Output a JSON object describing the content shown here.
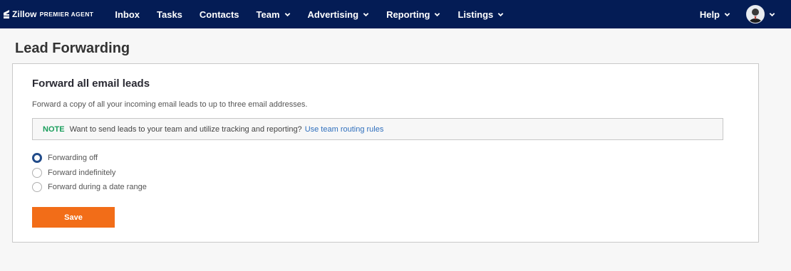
{
  "nav": {
    "brand_name": "Zillow",
    "brand_sub": "PREMIER AGENT",
    "items": [
      {
        "label": "Inbox",
        "dropdown": false
      },
      {
        "label": "Tasks",
        "dropdown": false
      },
      {
        "label": "Contacts",
        "dropdown": false
      },
      {
        "label": "Team",
        "dropdown": true
      },
      {
        "label": "Advertising",
        "dropdown": true
      },
      {
        "label": "Reporting",
        "dropdown": true
      },
      {
        "label": "Listings",
        "dropdown": true
      }
    ],
    "help_label": "Help",
    "bg_color": "#041c55"
  },
  "page": {
    "title": "Lead Forwarding"
  },
  "card": {
    "heading": "Forward all email leads",
    "description": "Forward a copy of all your incoming email leads to up to three email addresses.",
    "note": {
      "tag": "NOTE",
      "text": "Want to send leads to your team and utilize tracking and reporting?",
      "link": "Use team routing rules"
    },
    "options": [
      {
        "label": "Forwarding off",
        "selected": true
      },
      {
        "label": "Forward indefinitely",
        "selected": false
      },
      {
        "label": "Forward during a date range",
        "selected": false
      }
    ],
    "save_label": "Save"
  },
  "colors": {
    "accent": "#f26d18",
    "note_green": "#1a9e5c",
    "link_blue": "#2f6fbd",
    "radio_selected": "#224c8a"
  }
}
